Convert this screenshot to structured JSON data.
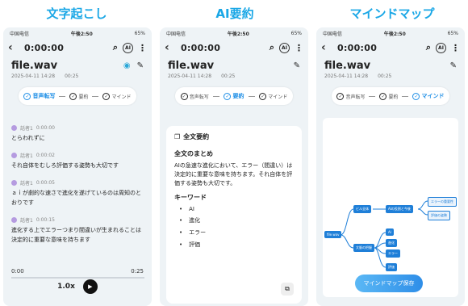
{
  "titles": [
    "文字起こし",
    "AI要約",
    "マインドマップ"
  ],
  "status": {
    "carrier": "中国电信",
    "time": "午後2:50",
    "battery": "65%"
  },
  "nav": {
    "time": "0:00:00",
    "ai": "AI"
  },
  "file": {
    "name": "file.wav",
    "date": "2025-04-11 14:28",
    "duration": "00:25"
  },
  "steps": [
    "音声転写",
    "要約",
    "マインド"
  ],
  "segments": [
    {
      "speaker": "話者1",
      "time": "0:00:00",
      "text": "とらわれずに"
    },
    {
      "speaker": "話者1",
      "time": "0:00:02",
      "text": "それ自体をむしろ評価する姿勢も大切です"
    },
    {
      "speaker": "話者1",
      "time": "0:00:05",
      "text": "ａｉが劇的な速さで進化を遂げているのは周知のとおりです"
    },
    {
      "speaker": "話者1",
      "time": "0:00:15",
      "text": "進化する上でエラーつまり間違いが生まれることは決定的に重要な意味を持ちます"
    }
  ],
  "player": {
    "start": "0:00",
    "end": "0:25",
    "speed": "1.0x"
  },
  "summary": {
    "header": "全文要約",
    "title": "全文のまとめ",
    "body": "AIの急速な進化において、エラー（間違い）は決定的に重要な意味を持ちます。それ自体を評価する姿勢も大切です。",
    "kw_title": "キーワード",
    "keywords": [
      "AI",
      "進化",
      "エラー",
      "評価"
    ]
  },
  "mindmap": {
    "root": "file.wav",
    "b1": "ビル全体",
    "b1c": "AIの役割と今後",
    "l1": "エラーの重要性",
    "l2": "評価の姿勢",
    "b2": "文脈の把握",
    "c1": "AI",
    "c2": "進化",
    "c3": "エラー",
    "c4": "評価",
    "save": "マインドマップ保存"
  }
}
